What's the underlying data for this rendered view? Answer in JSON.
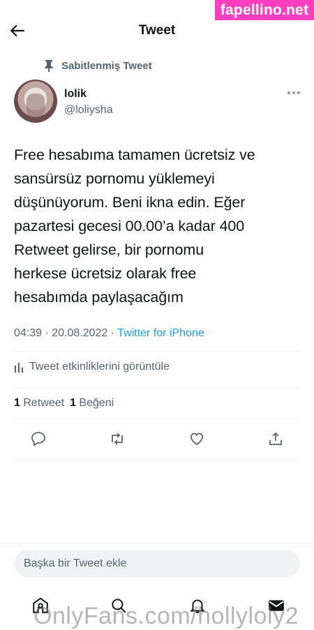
{
  "watermark_top": "fapellino.net",
  "header": {
    "title": "Tweet"
  },
  "pinned_label": "Sabitlenmiş Tweet",
  "user": {
    "name": "lolik",
    "handle": "@loliysha"
  },
  "tweet": {
    "text": "Free hesabıma tamamen ücretsiz ve\nsansürsüz pornomu yüklemeyi\ndüşünüyorum. Beni ikna edin. Eğer\npazartesi gecesi 00.00’a kadar 400\nRetweet gelirse, bir pornomu\nherkese ücretsiz olarak free\nhesabımda paylaşacağım",
    "time": "04:39 · 20.08.2022 · ",
    "source": "Twitter for iPhone"
  },
  "analytics_label": "Tweet etkinliklerini görüntüle",
  "counts": {
    "retweets_value": "1",
    "retweets_label": "Retweet",
    "likes_value": "1",
    "likes_label": "Beğeni"
  },
  "reply": {
    "placeholder": "Başka bir Tweet ekle"
  },
  "watermark_bottom": "OnlyFans.com/hollyloly2",
  "icons": {
    "back": "arrow-left-icon",
    "pin": "pin-icon",
    "more": "more-horizontal-icon",
    "analytics": "bar-chart-icon",
    "reply": "comment-icon",
    "retweet": "retweet-icon",
    "like": "heart-icon",
    "share": "share-icon",
    "home": "home-icon",
    "search": "search-icon",
    "notifications": "bell-icon",
    "messages": "mail-icon"
  },
  "colors": {
    "accent": "#1d9bf0",
    "secondary_text": "#536471",
    "watermark_bg": "#ff3fbf"
  }
}
